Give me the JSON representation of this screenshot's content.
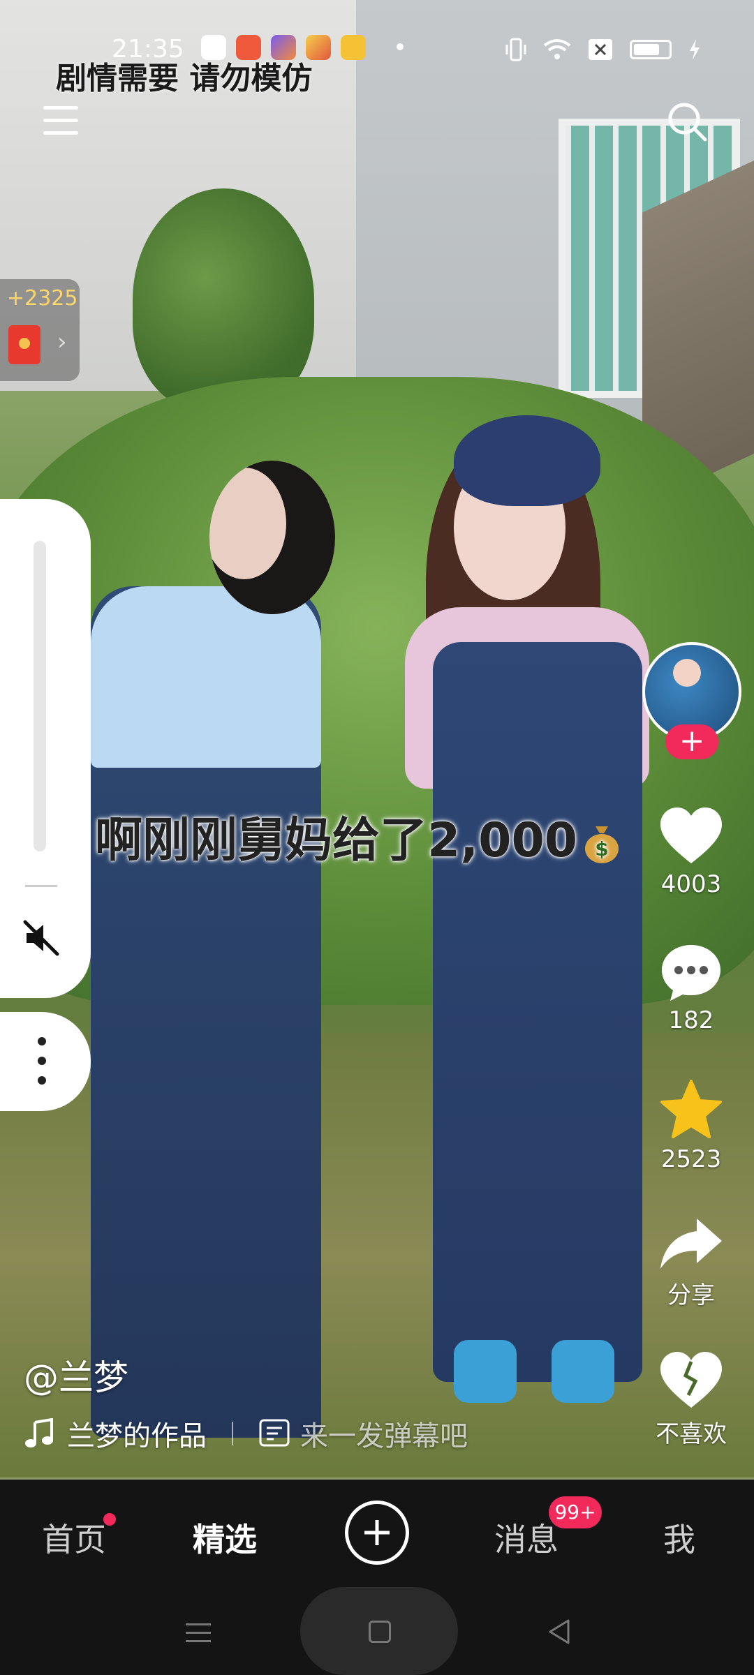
{
  "status_bar": {
    "time": "21:35"
  },
  "banner": {
    "warning_text": "剧情需要 请勿模仿"
  },
  "reward": {
    "count": "+2325"
  },
  "video": {
    "subtitle": "啊刚刚舅妈给了2,000"
  },
  "actions": {
    "likes": "4003",
    "comments": "182",
    "favorites": "2523",
    "share_label": "分享",
    "dislike_label": "不喜欢"
  },
  "author": {
    "handle": "@兰梦"
  },
  "music": {
    "title": "兰梦的作品"
  },
  "danmaku": {
    "placeholder": "来一发弹幕吧"
  },
  "tabs": {
    "home": "首页",
    "featured": "精选",
    "messages": "消息",
    "messages_badge": "99+",
    "me": "我"
  },
  "colors": {
    "accent": "#f2295b",
    "tab_bg": "#141414",
    "reward_text": "#ffd66b"
  }
}
